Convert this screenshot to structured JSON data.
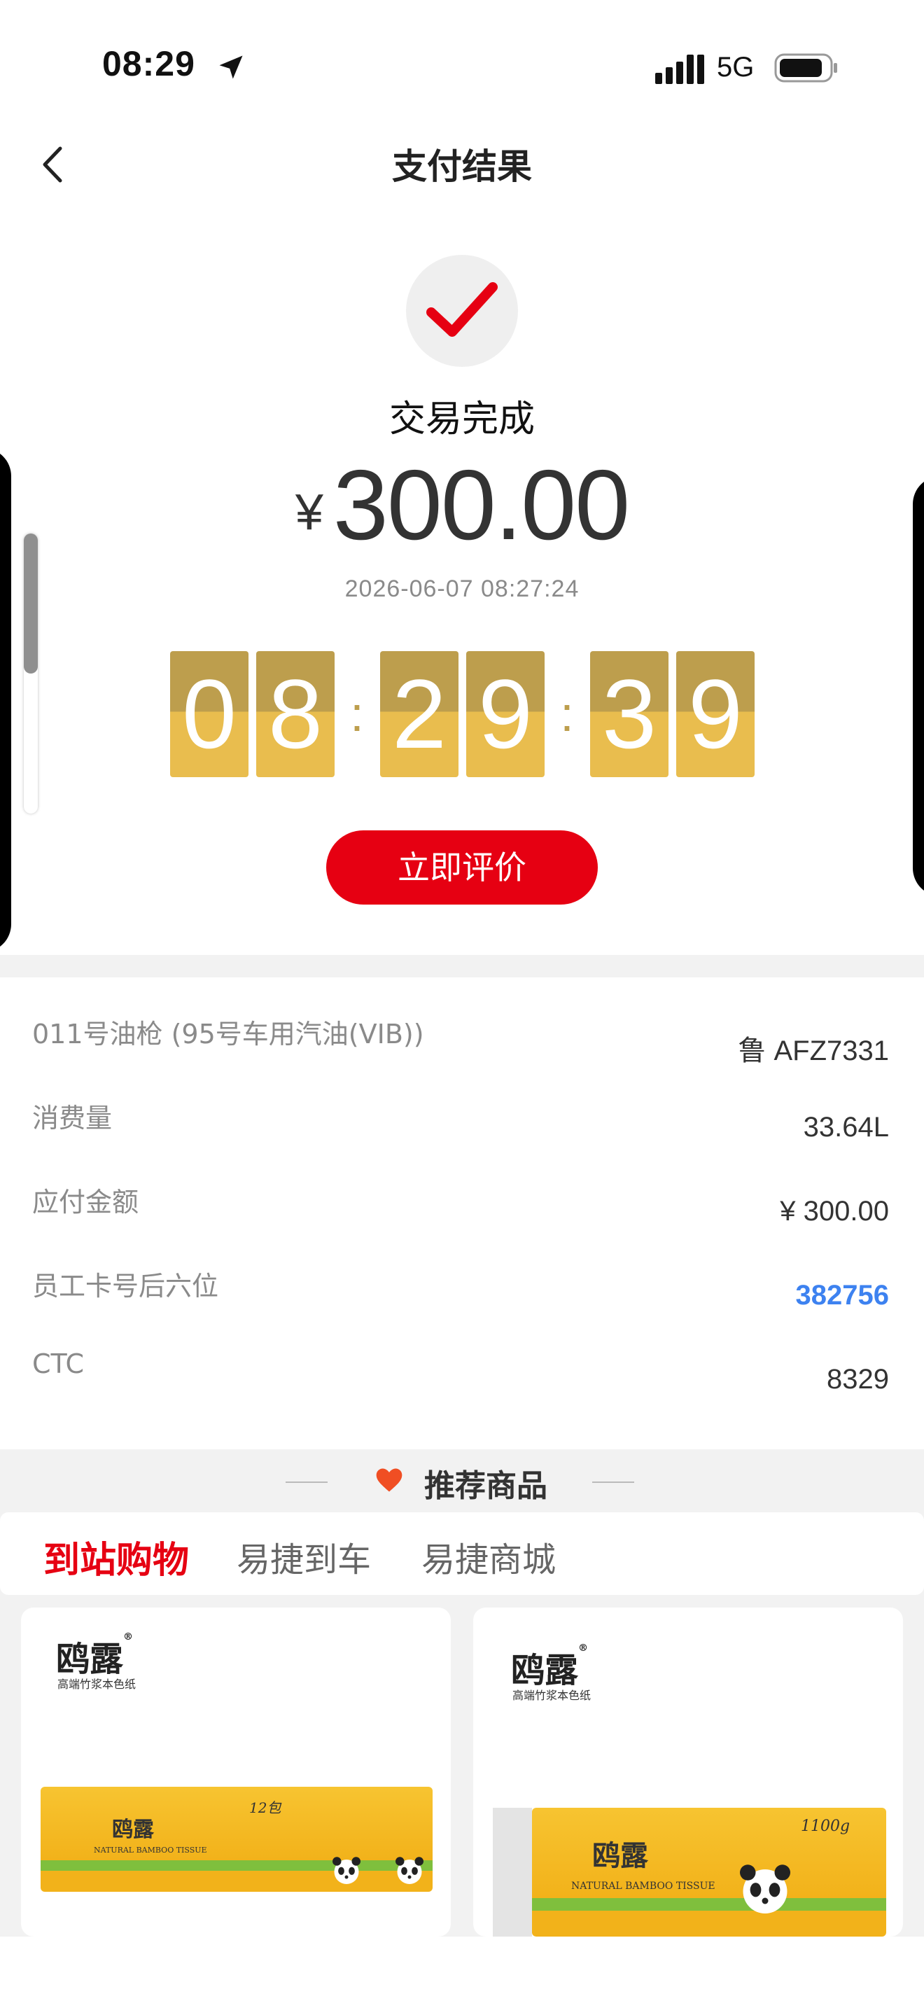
{
  "status_bar": {
    "time": "08:29",
    "network": "5G"
  },
  "nav": {
    "title": "支付结果"
  },
  "result": {
    "status": "交易完成",
    "currency_symbol": "¥",
    "amount": "300.00",
    "datetime": "2026-06-07 08:27:24"
  },
  "clock": {
    "d": [
      "0",
      "8",
      "2",
      "9",
      "3",
      "9"
    ],
    "sep": ":"
  },
  "rate_button": "立即评价",
  "details": [
    {
      "label": "011号油枪 (95号车用汽油(VIB))",
      "value": "鲁 AFZ7331"
    },
    {
      "label": "消费量",
      "value": "33.64L"
    },
    {
      "label": "应付金额",
      "value": "¥ 300.00"
    },
    {
      "label": "员工卡号后六位",
      "value": "382756"
    },
    {
      "label": "CTC",
      "value": "8329"
    }
  ],
  "recommend": {
    "title": "推荐商品",
    "tabs": [
      "到站购物",
      "易捷到车",
      "易捷商城"
    ],
    "products": [
      {
        "brand": "鸥露",
        "brand_sub": "高端竹浆本色纸",
        "pack_text": "NATURAL BAMBOO TISSUE",
        "count": "12包"
      },
      {
        "brand": "鸥露",
        "brand_sub": "高端竹浆本色纸",
        "pack_text": "NATURAL BAMBOO TISSUE",
        "count": "1100g"
      }
    ]
  },
  "colors": {
    "accent_red": "#e60012",
    "clock_top": "#bd9e4d",
    "clock_bottom": "#e9bd4e",
    "link_blue": "#3d82f0"
  }
}
